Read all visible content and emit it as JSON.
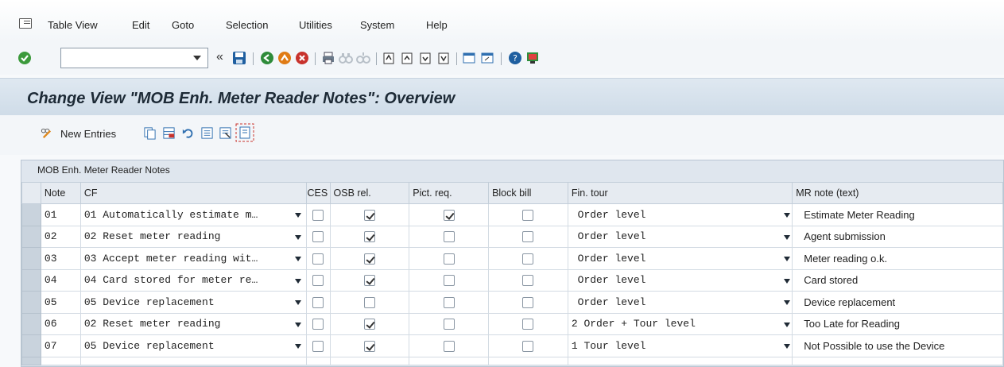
{
  "menu": [
    "Table View",
    "Edit",
    "Goto",
    "Selection",
    "Utilities",
    "System",
    "Help"
  ],
  "toolbar": {
    "command_value": ""
  },
  "title": "Change View \"MOB Enh. Meter Reader Notes\": Overview",
  "app_toolbar": {
    "new_entries": "New Entries"
  },
  "table": {
    "caption": "MOB Enh. Meter Reader Notes",
    "headers": {
      "note": "Note",
      "cf": "CF",
      "ces": "CES",
      "osb": "OSB rel.",
      "pict": "Pict. req.",
      "block": "Block bill",
      "fin": "Fin. tour",
      "mr": "MR note (text)"
    },
    "rows": [
      {
        "note": "01",
        "cf": "01 Automatically estimate m…",
        "ces": false,
        "osb": true,
        "pict": true,
        "block": false,
        "fin": " Order level",
        "mr": "Estimate Meter Reading"
      },
      {
        "note": "02",
        "cf": "02 Reset meter reading",
        "ces": false,
        "osb": true,
        "pict": false,
        "block": false,
        "fin": " Order level",
        "mr": "Agent submission"
      },
      {
        "note": "03",
        "cf": "03 Accept meter reading wit…",
        "ces": false,
        "osb": true,
        "pict": false,
        "block": false,
        "fin": " Order level",
        "mr": "Meter reading o.k."
      },
      {
        "note": "04",
        "cf": "04 Card stored for meter re…",
        "ces": false,
        "osb": true,
        "pict": false,
        "block": false,
        "fin": " Order level",
        "mr": "Card stored"
      },
      {
        "note": "05",
        "cf": "05 Device replacement",
        "ces": false,
        "osb": false,
        "pict": false,
        "block": false,
        "fin": " Order level",
        "mr": "Device replacement"
      },
      {
        "note": "06",
        "cf": "02 Reset meter reading",
        "ces": false,
        "osb": true,
        "pict": false,
        "block": false,
        "fin": "2 Order + Tour level",
        "mr": "Too Late for Reading"
      },
      {
        "note": "07",
        "cf": "05 Device replacement",
        "ces": false,
        "osb": true,
        "pict": false,
        "block": false,
        "fin": "1 Tour level",
        "mr": "Not Possible to use the Device"
      }
    ]
  },
  "colors": {
    "title_bg": "#d4e0eb",
    "confirm_green": "#3c9a3c",
    "back_green": "#2e8b3a",
    "exit_orange": "#e07b14",
    "cancel_red": "#c8322c",
    "save_blue": "#1f5fa0"
  }
}
